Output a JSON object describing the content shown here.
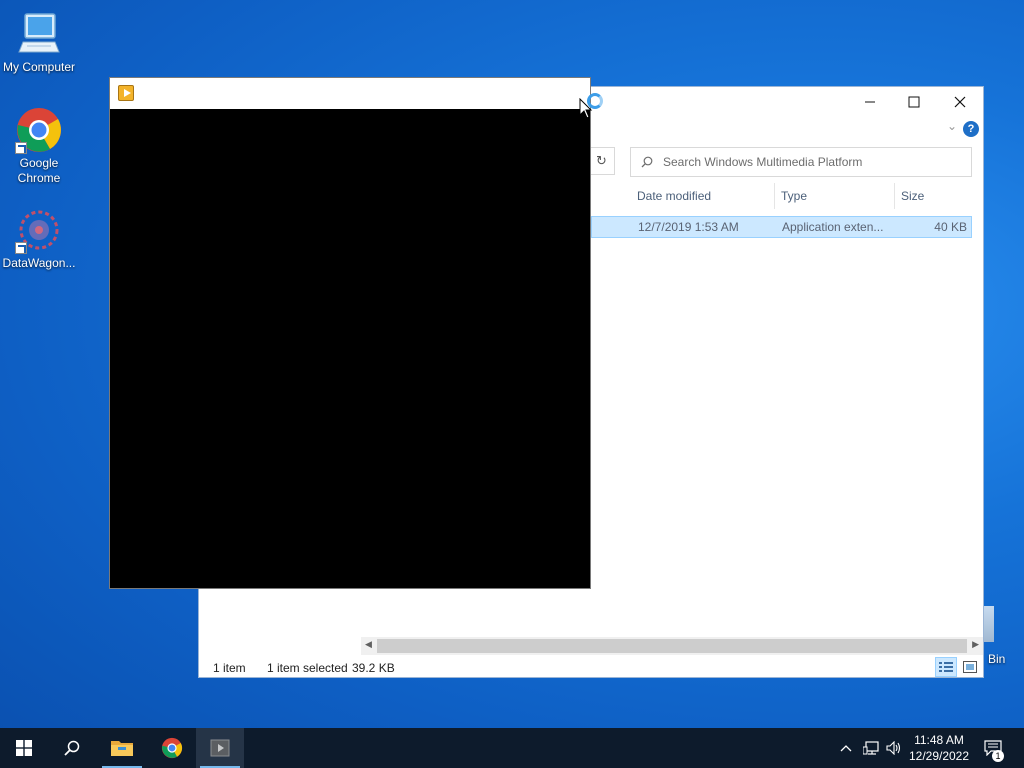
{
  "desktop": {
    "icons": [
      {
        "label": "My Computer"
      },
      {
        "label": "Google Chrome"
      },
      {
        "label": "DataWagon..."
      }
    ],
    "recycle_bin_partial_label": "Bin"
  },
  "explorer": {
    "search_placeholder": "Search Windows Multimedia Platform",
    "columns": {
      "date_modified": "Date modified",
      "type": "Type",
      "size": "Size"
    },
    "rows": [
      {
        "date_modified": "12/7/2019 1:53 AM",
        "type": "Application exten...",
        "size": "40 KB"
      }
    ],
    "status": {
      "item_count": "1 item",
      "selected": "1 item selected",
      "selected_size": "39.2 KB"
    }
  },
  "taskbar": {
    "clock_time": "11:48 AM",
    "clock_date": "12/29/2022",
    "notification_count": "1"
  },
  "colors": {
    "selection_bg": "#cce8ff",
    "taskbar_bg": "#0d1b2c",
    "accent": "#1e6fc7"
  }
}
